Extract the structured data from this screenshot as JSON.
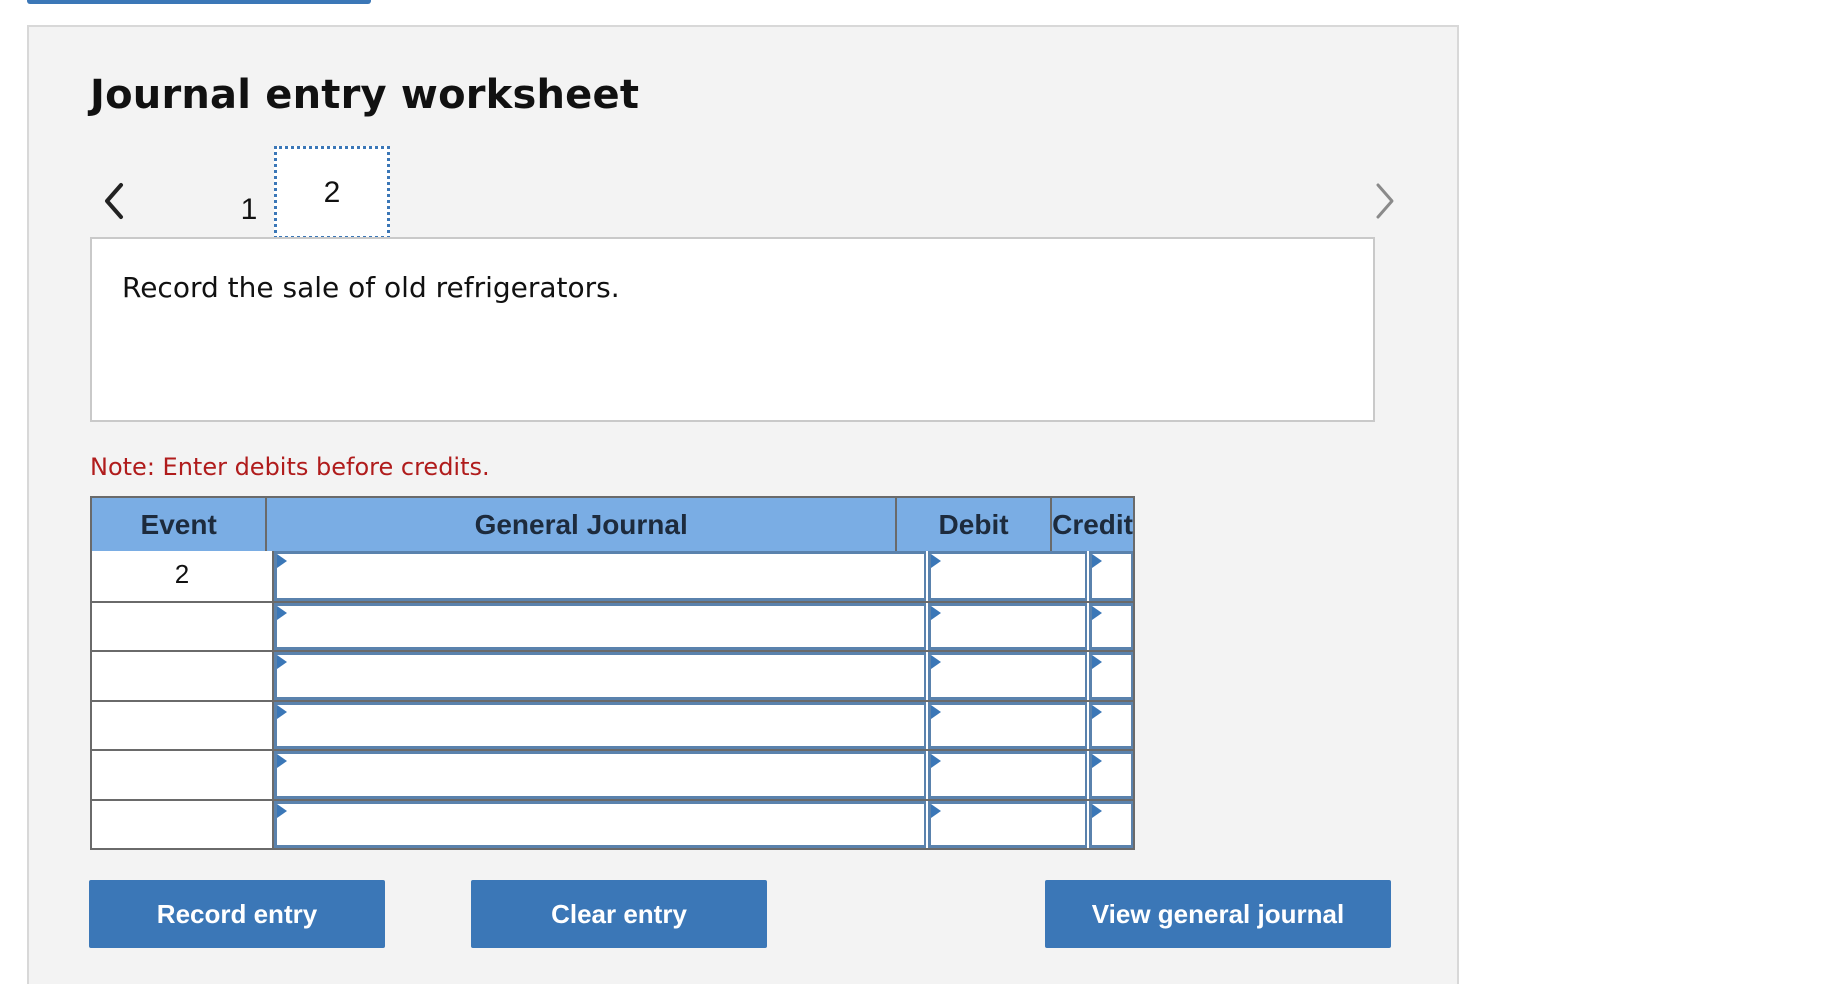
{
  "worksheet": {
    "title": "Journal entry worksheet",
    "pages": [
      "1",
      "2"
    ],
    "active_page": "2",
    "prompt": "Record the sale of old refrigerators.",
    "note": "Note: Enter debits before credits."
  },
  "journal": {
    "headers": {
      "event": "Event",
      "general_journal": "General Journal",
      "debit": "Debit",
      "credit": "Credit"
    },
    "rows": [
      {
        "event": "2",
        "account": "",
        "debit": "",
        "credit": ""
      },
      {
        "event": "",
        "account": "",
        "debit": "",
        "credit": ""
      },
      {
        "event": "",
        "account": "",
        "debit": "",
        "credit": ""
      },
      {
        "event": "",
        "account": "",
        "debit": "",
        "credit": ""
      },
      {
        "event": "",
        "account": "",
        "debit": "",
        "credit": ""
      },
      {
        "event": "",
        "account": "",
        "debit": "",
        "credit": ""
      }
    ]
  },
  "buttons": {
    "record": "Record entry",
    "clear": "Clear entry",
    "view": "View general journal"
  },
  "icons": {
    "prev": "chevron-left-icon",
    "next": "chevron-right-icon",
    "row_marker": "triangle-right-icon"
  },
  "colors": {
    "accent": "#3b77b7",
    "header_bg": "#7aade4",
    "note": "#b01c1c",
    "panel_bg": "#f3f3f3"
  }
}
